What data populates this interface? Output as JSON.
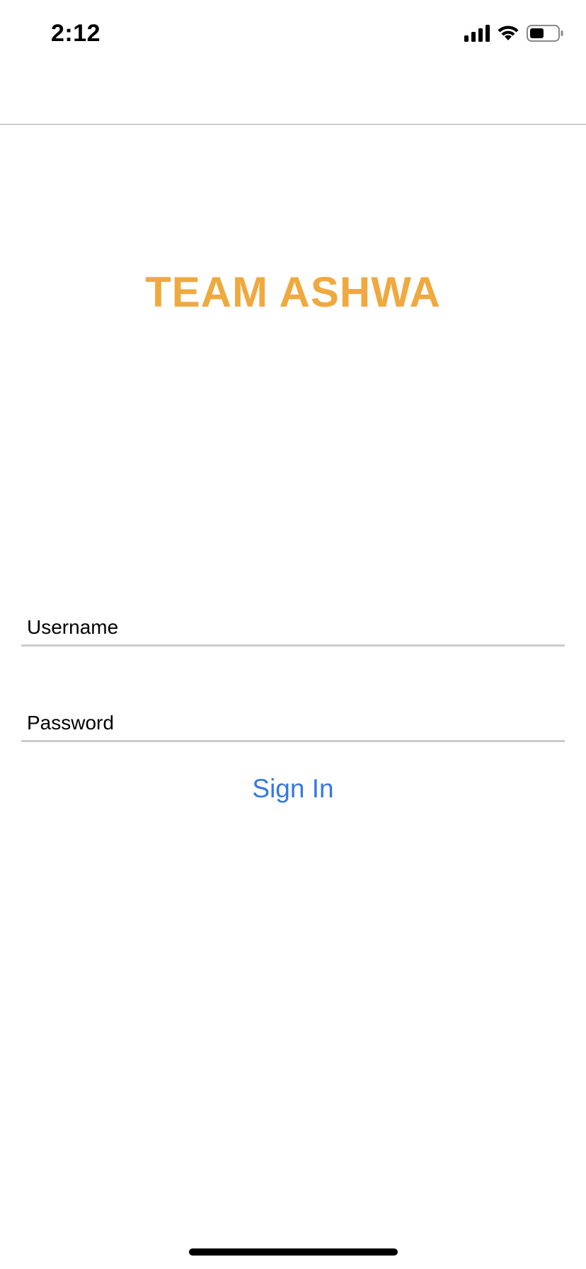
{
  "status_bar": {
    "time": "2:12",
    "icons": [
      "signal-icon",
      "wifi-icon",
      "battery-icon"
    ]
  },
  "app": {
    "brand_title": "TEAM ASHWA",
    "brand_color": "#f0a93e"
  },
  "login": {
    "username_placeholder": "Username",
    "password_placeholder": "Password",
    "sign_in_label": "Sign In",
    "accent_color": "#3478e4"
  }
}
